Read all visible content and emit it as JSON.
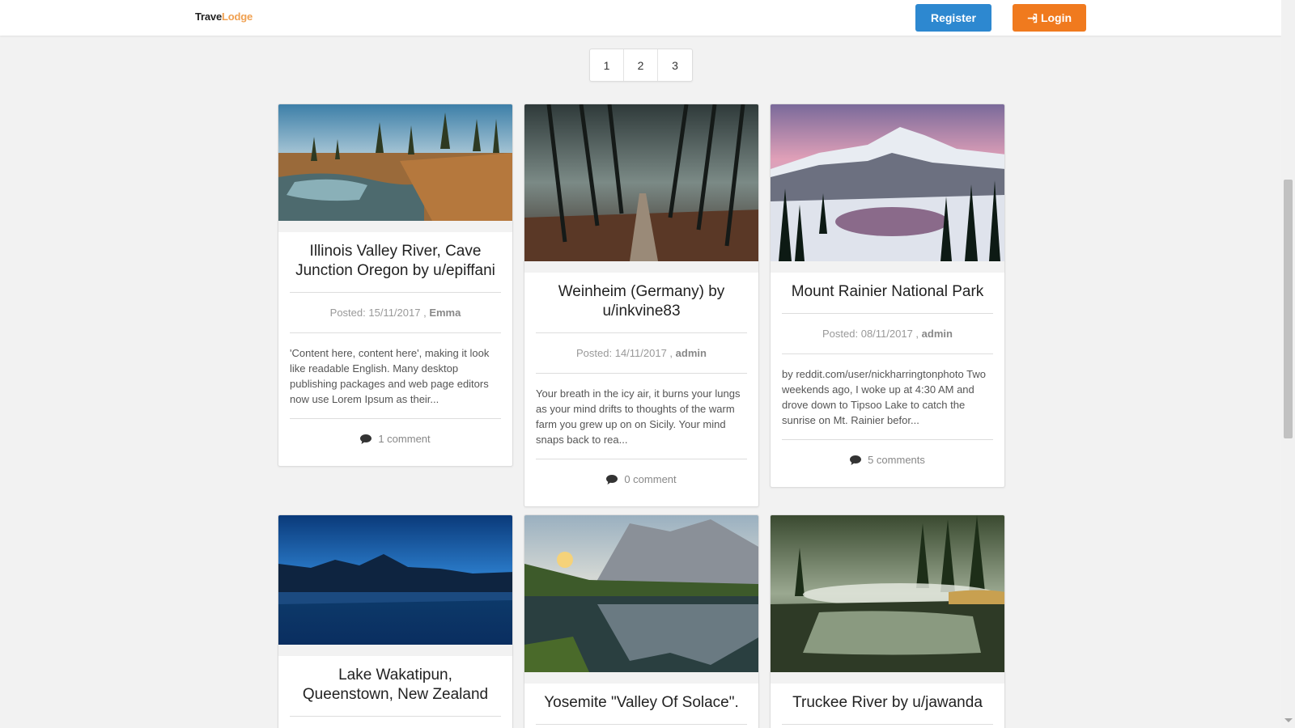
{
  "header": {
    "logo_part1": "Trave",
    "logo_part2": "Lodge",
    "register_label": "Register",
    "login_label": "Login"
  },
  "pagination": [
    "1",
    "2",
    "3"
  ],
  "posts": [
    {
      "title": "Illinois Valley River, Cave Junction Oregon by u/epiffani",
      "date": "Posted: 15/11/2017 ,",
      "author": "Emma",
      "excerpt": "'Content here, content here', making it look like readable English. Many desktop publishing packages and web page editors now use Lorem Ipsum as their...",
      "comments": "1 comment"
    },
    {
      "title": "Weinheim (Germany) by u/inkvine83",
      "date": "Posted: 14/11/2017 ,",
      "author": "admin",
      "excerpt": "Your breath in the icy air, it burns your lungs as your mind drifts to thoughts of the warm farm you grew up on on Sicily. Your mind snaps back to rea...",
      "comments": "0 comment"
    },
    {
      "title": "Mount Rainier National Park",
      "date": "Posted: 08/11/2017 ,",
      "author": "admin",
      "excerpt": "by reddit.com/user/nickharringtonphoto Two weekends ago, I woke up at 4:30 AM and drove down to Tipsoo Lake to catch the sunrise on Mt. Rainier befor...",
      "comments": "5 comments"
    },
    {
      "title": "Lake Wakatipun, Queenstown, New Zealand"
    },
    {
      "title": "Yosemite \"Valley Of Solace\"."
    },
    {
      "title": "Truckee River by u/jawanda"
    }
  ],
  "colors": {
    "register": "#2d88d0",
    "login": "#f07a1e",
    "logo_accent": "#f0a050",
    "background": "#f2f2f2"
  },
  "icons": {
    "login": "sign-in-icon",
    "comments": "comment-icon"
  }
}
